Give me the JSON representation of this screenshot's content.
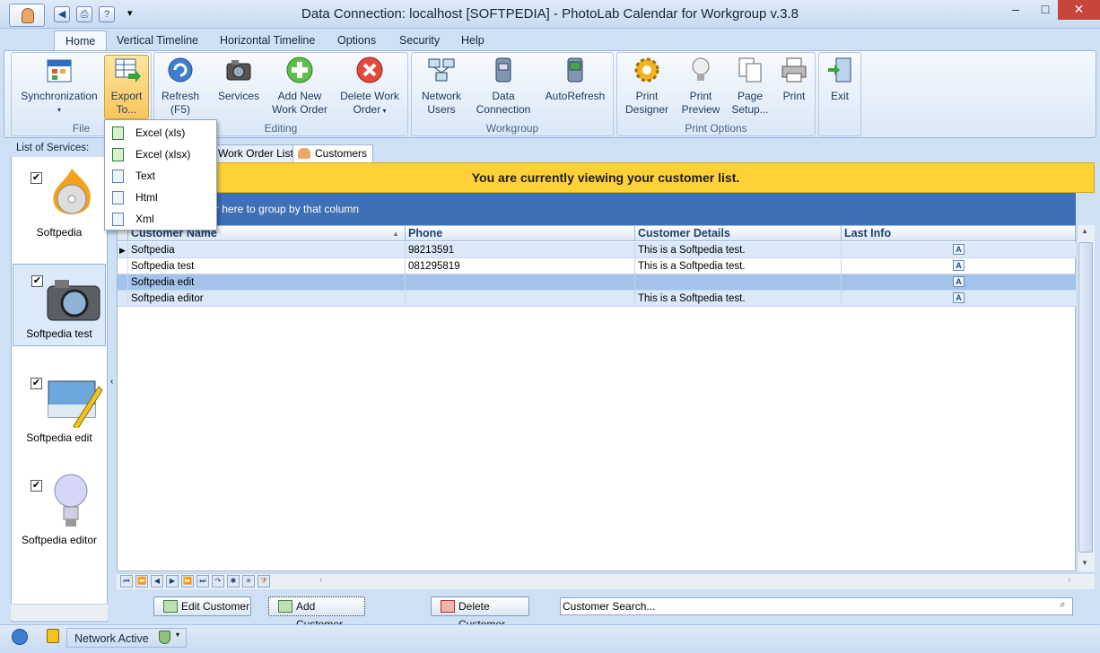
{
  "window": {
    "title": "Data Connection: localhost [SOFTPEDIA] - PhotoLab Calendar for Workgroup v.3.8",
    "minimize": "–",
    "maximize": "□",
    "close": "✕"
  },
  "quick_access": [
    "◀",
    "⎙",
    "?",
    "▾"
  ],
  "tabs": [
    "Home",
    "Vertical Timeline",
    "Horizontal Timeline",
    "Options",
    "Security",
    "Help"
  ],
  "ribbon": {
    "groups": [
      "File",
      "Editing",
      "Workgroup",
      "Print Options"
    ],
    "buttons": {
      "synchronization": "Synchronization",
      "export_l1": "Export",
      "export_l2": "To...",
      "refresh_l1": "Refresh",
      "refresh_l2": "(F5)",
      "services": "Services",
      "add_wo_l1": "Add New",
      "add_wo_l2": "Work Order",
      "delete_wo_l1": "Delete Work",
      "delete_wo_l2": "Order",
      "network_l1": "Network",
      "network_l2": "Users",
      "dataconn_l1": "Data",
      "dataconn_l2": "Connection",
      "autorefresh": "AutoRefresh",
      "print_designer_l1": "Print",
      "print_designer_l2": "Designer",
      "print_preview_l1": "Print",
      "print_preview_l2": "Preview",
      "page_setup_l1": "Page",
      "page_setup_l2": "Setup...",
      "print": "Print",
      "exit": "Exit"
    }
  },
  "export_menu": [
    "Excel (xls)",
    "Excel (xlsx)",
    "Text",
    "Html",
    "Xml"
  ],
  "left_panel": {
    "header": "List of Services:",
    "services": [
      {
        "label": "Softpedia",
        "checked": true
      },
      {
        "label": "Softpedia test",
        "checked": true
      },
      {
        "label": "Softpedia edit",
        "checked": true
      },
      {
        "label": "Softpedia editor",
        "checked": true
      }
    ],
    "check_mark": "✔"
  },
  "doc_tabs": [
    "Work Order List",
    "Customers"
  ],
  "banner": "You are currently viewing your customer list.",
  "group_hint": "r here to group by that column",
  "grid": {
    "columns": [
      "Customer Name",
      "Phone",
      "Customer Details",
      "Last Info"
    ],
    "sort_indicator": "▲",
    "rows": [
      {
        "name": "Softpedia",
        "phone": "98213591",
        "details": "This is a Softpedia test."
      },
      {
        "name": "Softpedia test",
        "phone": "081295819",
        "details": "This is a Softpedia test."
      },
      {
        "name": "Softpedia edit",
        "phone": "",
        "details": ""
      },
      {
        "name": "Softpedia editor",
        "phone": "",
        "details": "This is a Softpedia test."
      }
    ],
    "info_glyph": "A",
    "row_pointer": "▶"
  },
  "nav_buttons": [
    "⏮",
    "⏪",
    "◀",
    "▶",
    "⏩",
    "⏭",
    "↷",
    "✱",
    "✳",
    "⧩"
  ],
  "actions": {
    "edit": "Edit Customer",
    "add": "Add Customer",
    "delete": "Delete Customer",
    "search_placeholder": "Customer Search..."
  },
  "status": {
    "network": "Network Active"
  },
  "colors": {
    "banner": "#fed137",
    "group_bar": "#3f6fb5",
    "selected_row": "#a4c2ea"
  }
}
